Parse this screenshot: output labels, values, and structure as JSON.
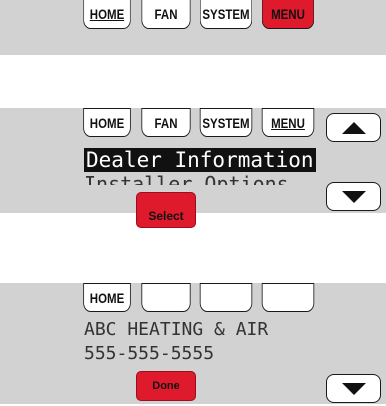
{
  "screen1": {
    "tabs": [
      {
        "label": "HOME"
      },
      {
        "label": "FAN"
      },
      {
        "label": "SYSTEM"
      },
      {
        "label": "MENU"
      }
    ]
  },
  "screen2": {
    "tabs": [
      {
        "label": "HOME"
      },
      {
        "label": "FAN"
      },
      {
        "label": "SYSTEM"
      },
      {
        "label": "MENU"
      }
    ],
    "selected_item": "Dealer Information",
    "next_item": "Installer Options",
    "select_button": "Select",
    "up_icon": "up-arrow-icon",
    "down_icon": "down-arrow-icon"
  },
  "screen3": {
    "tabs": [
      {
        "label": "HOME"
      },
      {
        "label": ""
      },
      {
        "label": ""
      },
      {
        "label": ""
      }
    ],
    "dealer_name": "ABC HEATING & AIR",
    "dealer_phone": "555-555-5555",
    "done_button": "Done",
    "down_icon": "down-arrow-icon"
  },
  "colors": {
    "panel_bg": "#d2d2d3",
    "active_tab": "#e01a2d",
    "button_red": "#e01a2d",
    "lcd_text": "#222222"
  }
}
